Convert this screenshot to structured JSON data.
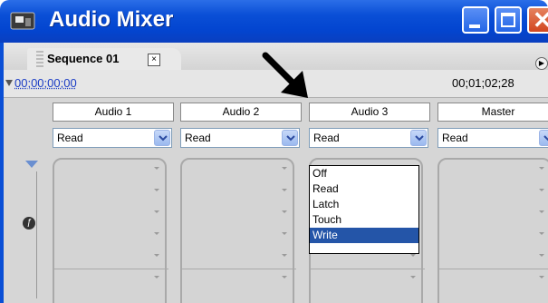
{
  "window": {
    "title": "Audio Mixer",
    "buttons": {
      "min": "minimize",
      "max": "maximize",
      "close": "close"
    }
  },
  "tab": {
    "label": "Sequence 01",
    "close": "×"
  },
  "time": {
    "left": "00;00;00;00",
    "right": "00;01;02;28"
  },
  "channels": [
    {
      "label": "Audio 1",
      "mode": "Read"
    },
    {
      "label": "Audio 2",
      "mode": "Read"
    },
    {
      "label": "Audio 3",
      "mode": "Read"
    },
    {
      "label": "Master",
      "mode": "Read"
    }
  ],
  "dropdown": {
    "options": [
      "Off",
      "Read",
      "Latch",
      "Touch",
      "Write"
    ],
    "highlighted": "Write"
  },
  "left_controls": {
    "fx": "ƒ"
  }
}
